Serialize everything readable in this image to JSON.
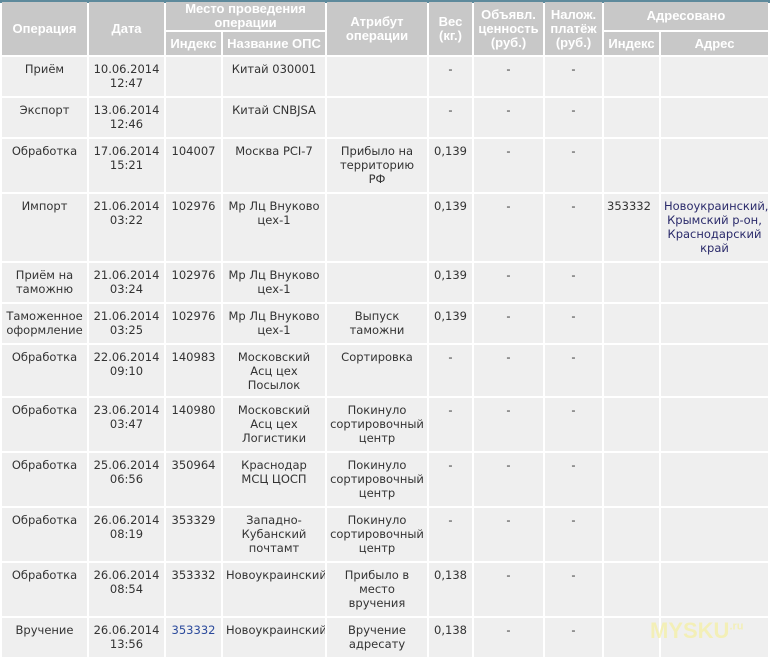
{
  "headers": {
    "operation": "Операция",
    "date": "Дата",
    "place": "Место проведения операции",
    "place_index": "Индекс",
    "place_name": "Название ОПС",
    "attribute": "Атрибут операции",
    "weight": "Вес (кг.)",
    "declared": "Объявл. ценность (руб.)",
    "cod": "Налож. платёж (руб.)",
    "addressed": "Адресовано",
    "addr_index": "Индекс",
    "addr": "Адрес"
  },
  "rows": [
    {
      "op": "Приём",
      "date": "10.06.2014 12:47",
      "idx": "",
      "name": "Китай 030001",
      "attr": "",
      "weight": "-",
      "declared": "-",
      "cod": "-",
      "aidx": "",
      "addr": ""
    },
    {
      "op": "Экспорт",
      "date": "13.06.2014 12:46",
      "idx": "",
      "name": "Китай CNBJSA",
      "attr": "",
      "weight": "-",
      "declared": "-",
      "cod": "-",
      "aidx": "",
      "addr": ""
    },
    {
      "op": "Обработка",
      "date": "17.06.2014 15:21",
      "idx": "104007",
      "name": "Москва PCI-7",
      "attr": "Прибыло на территорию РФ",
      "weight": "0,139",
      "declared": "-",
      "cod": "-",
      "aidx": "",
      "addr": ""
    },
    {
      "op": "Импорт",
      "date": "21.06.2014 03:22",
      "idx": "102976",
      "name": "Мр Лц Внуково цех-1",
      "attr": "",
      "weight": "0,139",
      "declared": "-",
      "cod": "-",
      "aidx": "353332",
      "addr": "Новоукраинский, Крымский р-он, Краснодарский край"
    },
    {
      "op": "Приём на таможню",
      "date": "21.06.2014 03:24",
      "idx": "102976",
      "name": "Мр Лц Внуково цех-1",
      "attr": "",
      "weight": "0,139",
      "declared": "-",
      "cod": "-",
      "aidx": "",
      "addr": ""
    },
    {
      "op": "Таможенное оформление",
      "date": "21.06.2014 03:25",
      "idx": "102976",
      "name": "Мр Лц Внуково цех-1",
      "attr": "Выпуск таможни",
      "weight": "0,139",
      "declared": "-",
      "cod": "-",
      "aidx": "",
      "addr": ""
    },
    {
      "op": "Обработка",
      "date": "22.06.2014 09:10",
      "idx": "140983",
      "name": "Московский Асц цех Посылок",
      "attr": "Сортировка",
      "weight": "-",
      "declared": "-",
      "cod": "-",
      "aidx": "",
      "addr": ""
    },
    {
      "op": "Обработка",
      "date": "23.06.2014 03:47",
      "idx": "140980",
      "name": "Московский Асц цех Логистики",
      "attr": "Покинуло сортировочный центр",
      "weight": "-",
      "declared": "-",
      "cod": "-",
      "aidx": "",
      "addr": ""
    },
    {
      "op": "Обработка",
      "date": "25.06.2014 06:56",
      "idx": "350964",
      "name": "Краснодар МСЦ ЦОСП",
      "attr": "Покинуло сортировочный центр",
      "weight": "-",
      "declared": "-",
      "cod": "-",
      "aidx": "",
      "addr": ""
    },
    {
      "op": "Обработка",
      "date": "26.06.2014 08:19",
      "idx": "353329",
      "name": "Западно-Кубанский почтамт",
      "attr": "Покинуло сортировочный центр",
      "weight": "-",
      "declared": "-",
      "cod": "-",
      "aidx": "",
      "addr": ""
    },
    {
      "op": "Обработка",
      "date": "26.06.2014 08:54",
      "idx": "353332",
      "name": "Новоукраинский",
      "attr": "Прибыло в место вручения",
      "weight": "0,138",
      "declared": "-",
      "cod": "-",
      "aidx": "",
      "addr": ""
    },
    {
      "op": "Вручение",
      "date": "26.06.2014 13:56",
      "idx": "353332",
      "name": "Новоукраинский",
      "attr": "Вручение адресату",
      "weight": "0,138",
      "declared": "-",
      "cod": "-",
      "aidx": "",
      "addr": ""
    }
  ],
  "watermark": "MYSKU.ru"
}
